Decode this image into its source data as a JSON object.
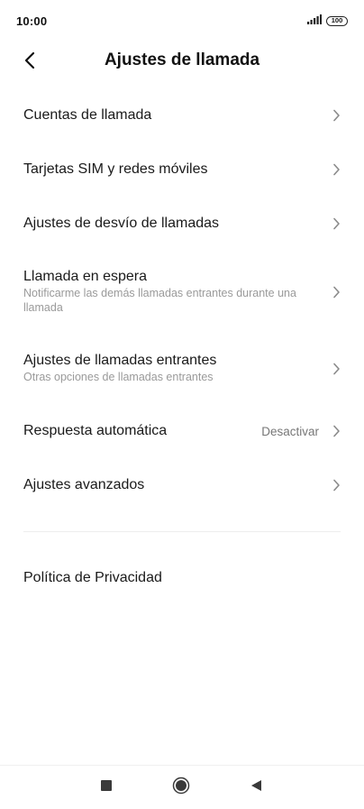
{
  "status_bar": {
    "time": "10:00",
    "battery": "100"
  },
  "header": {
    "title": "Ajustes de llamada"
  },
  "items": [
    {
      "title": "Cuentas de llamada",
      "subtitle": "",
      "value": ""
    },
    {
      "title": "Tarjetas SIM y redes móviles",
      "subtitle": "",
      "value": ""
    },
    {
      "title": "Ajustes de desvío de llamadas",
      "subtitle": "",
      "value": ""
    },
    {
      "title": "Llamada en espera",
      "subtitle": "Notificarme las demás llamadas entrantes durante una llamada",
      "value": ""
    },
    {
      "title": "Ajustes de llamadas entrantes",
      "subtitle": "Otras opciones de llamadas entrantes",
      "value": ""
    },
    {
      "title": "Respuesta automática",
      "subtitle": "",
      "value": "Desactivar"
    },
    {
      "title": "Ajustes avanzados",
      "subtitle": "",
      "value": ""
    }
  ],
  "privacy": {
    "label": "Política de Privacidad"
  },
  "icons": {
    "back": "chevron-left-icon",
    "item_arrow": "chevron-right-icon",
    "signal": "signal-icon",
    "battery": "battery-icon",
    "nav_recents": "square-icon",
    "nav_home": "circle-icon",
    "nav_back": "triangle-left-icon"
  }
}
